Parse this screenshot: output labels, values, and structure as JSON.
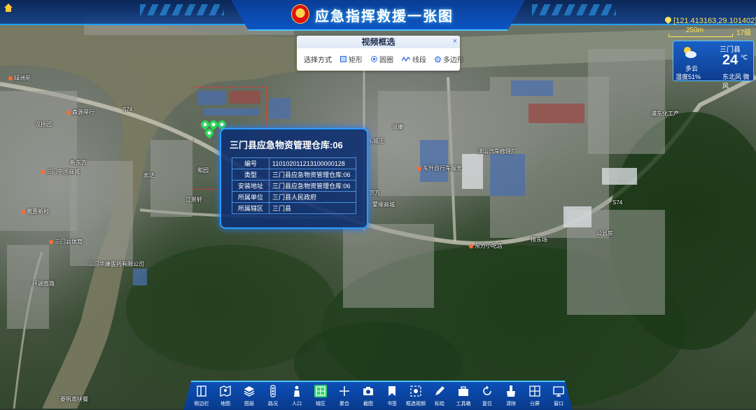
{
  "header": {
    "title": "应急指挥救援一张图",
    "coords": "[121.413163,29.101402]",
    "scale": "250m",
    "zoom_level": "17级"
  },
  "weather": {
    "city": "三门县",
    "temperature": "24",
    "unit": "℃",
    "condition": "多云",
    "humidity": "湿度51%",
    "wind": "东北风 微风"
  },
  "video_panel": {
    "title": "视频框选",
    "close": "×",
    "method_label": "选择方式",
    "options": [
      {
        "label": "矩形",
        "icon": "rectangle-icon"
      },
      {
        "label": "圆圈",
        "icon": "circle-icon"
      },
      {
        "label": "线段",
        "icon": "line-icon"
      },
      {
        "label": "多边形",
        "icon": "polygon-icon"
      }
    ]
  },
  "popup": {
    "title": "三门县应急物资管理仓库:06",
    "rows": [
      {
        "key": "编号",
        "value": "110102011213100000128"
      },
      {
        "key": "类型",
        "value": "三门县应急物资管理仓库:06"
      },
      {
        "key": "安装地址",
        "value": "三门县应急物资管理仓库:06"
      },
      {
        "key": "所属单位",
        "value": "三门县人民政府"
      },
      {
        "key": "所属辖区",
        "value": "三门县"
      }
    ]
  },
  "map_labels": [
    "绿洲苑",
    "森源琴行",
    "汉扬园",
    "三门中国商城",
    "新东方",
    "雅惠新村",
    "三门县体育",
    "三门华康医药有限公司",
    "环湖南路",
    "菱帆南扶餐",
    "宏达",
    "江景轩",
    "和园",
    "溢康",
    "东城庄",
    "京方",
    "蒙顺商城",
    "洋山汽车修理厂",
    "东升自行车服务",
    "东方小吃店",
    "榜东场",
    "公县房",
    "浦东化工产",
    "S74",
    "S74"
  ],
  "toolbar": {
    "items": [
      {
        "label": "侧边栏",
        "icon": "sidebar-icon"
      },
      {
        "label": "地图",
        "icon": "map-icon"
      },
      {
        "label": "图层",
        "icon": "layers-icon"
      },
      {
        "label": "路况",
        "icon": "traffic-light-icon"
      },
      {
        "label": "人口",
        "icon": "person-icon"
      },
      {
        "label": "辖区",
        "icon": "district-icon",
        "active": true
      },
      {
        "label": "聚合",
        "icon": "cluster-icon"
      },
      {
        "label": "截图",
        "icon": "camera-icon"
      },
      {
        "label": "书签",
        "icon": "bookmark-icon"
      },
      {
        "label": "框选视频",
        "icon": "frame-select-icon"
      },
      {
        "label": "标绘",
        "icon": "draw-icon"
      },
      {
        "label": "工具箱",
        "icon": "toolbox-icon"
      },
      {
        "label": "复位",
        "icon": "reset-icon"
      },
      {
        "label": "清除",
        "icon": "clear-icon"
      },
      {
        "label": "分屏",
        "icon": "split-screen-icon"
      },
      {
        "label": "窗口",
        "icon": "window-icon"
      }
    ]
  }
}
